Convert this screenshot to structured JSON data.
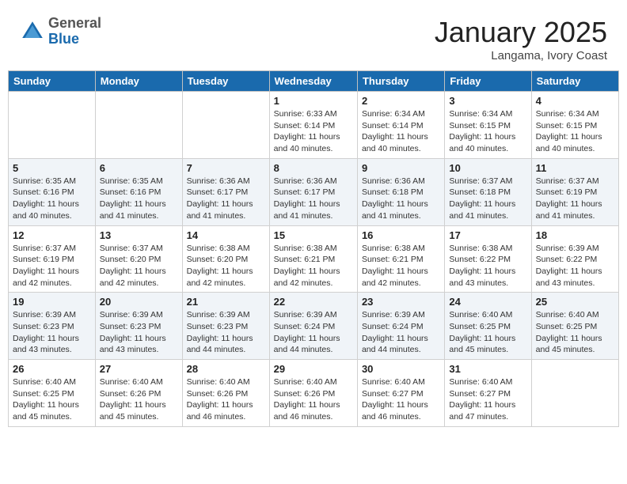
{
  "header": {
    "logo_general": "General",
    "logo_blue": "Blue",
    "month_title": "January 2025",
    "location": "Langama, Ivory Coast"
  },
  "weekdays": [
    "Sunday",
    "Monday",
    "Tuesday",
    "Wednesday",
    "Thursday",
    "Friday",
    "Saturday"
  ],
  "weeks": [
    [
      {
        "day": "",
        "info": ""
      },
      {
        "day": "",
        "info": ""
      },
      {
        "day": "",
        "info": ""
      },
      {
        "day": "1",
        "info": "Sunrise: 6:33 AM\nSunset: 6:14 PM\nDaylight: 11 hours and 40 minutes."
      },
      {
        "day": "2",
        "info": "Sunrise: 6:34 AM\nSunset: 6:14 PM\nDaylight: 11 hours and 40 minutes."
      },
      {
        "day": "3",
        "info": "Sunrise: 6:34 AM\nSunset: 6:15 PM\nDaylight: 11 hours and 40 minutes."
      },
      {
        "day": "4",
        "info": "Sunrise: 6:34 AM\nSunset: 6:15 PM\nDaylight: 11 hours and 40 minutes."
      }
    ],
    [
      {
        "day": "5",
        "info": "Sunrise: 6:35 AM\nSunset: 6:16 PM\nDaylight: 11 hours and 40 minutes."
      },
      {
        "day": "6",
        "info": "Sunrise: 6:35 AM\nSunset: 6:16 PM\nDaylight: 11 hours and 41 minutes."
      },
      {
        "day": "7",
        "info": "Sunrise: 6:36 AM\nSunset: 6:17 PM\nDaylight: 11 hours and 41 minutes."
      },
      {
        "day": "8",
        "info": "Sunrise: 6:36 AM\nSunset: 6:17 PM\nDaylight: 11 hours and 41 minutes."
      },
      {
        "day": "9",
        "info": "Sunrise: 6:36 AM\nSunset: 6:18 PM\nDaylight: 11 hours and 41 minutes."
      },
      {
        "day": "10",
        "info": "Sunrise: 6:37 AM\nSunset: 6:18 PM\nDaylight: 11 hours and 41 minutes."
      },
      {
        "day": "11",
        "info": "Sunrise: 6:37 AM\nSunset: 6:19 PM\nDaylight: 11 hours and 41 minutes."
      }
    ],
    [
      {
        "day": "12",
        "info": "Sunrise: 6:37 AM\nSunset: 6:19 PM\nDaylight: 11 hours and 42 minutes."
      },
      {
        "day": "13",
        "info": "Sunrise: 6:37 AM\nSunset: 6:20 PM\nDaylight: 11 hours and 42 minutes."
      },
      {
        "day": "14",
        "info": "Sunrise: 6:38 AM\nSunset: 6:20 PM\nDaylight: 11 hours and 42 minutes."
      },
      {
        "day": "15",
        "info": "Sunrise: 6:38 AM\nSunset: 6:21 PM\nDaylight: 11 hours and 42 minutes."
      },
      {
        "day": "16",
        "info": "Sunrise: 6:38 AM\nSunset: 6:21 PM\nDaylight: 11 hours and 42 minutes."
      },
      {
        "day": "17",
        "info": "Sunrise: 6:38 AM\nSunset: 6:22 PM\nDaylight: 11 hours and 43 minutes."
      },
      {
        "day": "18",
        "info": "Sunrise: 6:39 AM\nSunset: 6:22 PM\nDaylight: 11 hours and 43 minutes."
      }
    ],
    [
      {
        "day": "19",
        "info": "Sunrise: 6:39 AM\nSunset: 6:23 PM\nDaylight: 11 hours and 43 minutes."
      },
      {
        "day": "20",
        "info": "Sunrise: 6:39 AM\nSunset: 6:23 PM\nDaylight: 11 hours and 43 minutes."
      },
      {
        "day": "21",
        "info": "Sunrise: 6:39 AM\nSunset: 6:23 PM\nDaylight: 11 hours and 44 minutes."
      },
      {
        "day": "22",
        "info": "Sunrise: 6:39 AM\nSunset: 6:24 PM\nDaylight: 11 hours and 44 minutes."
      },
      {
        "day": "23",
        "info": "Sunrise: 6:39 AM\nSunset: 6:24 PM\nDaylight: 11 hours and 44 minutes."
      },
      {
        "day": "24",
        "info": "Sunrise: 6:40 AM\nSunset: 6:25 PM\nDaylight: 11 hours and 45 minutes."
      },
      {
        "day": "25",
        "info": "Sunrise: 6:40 AM\nSunset: 6:25 PM\nDaylight: 11 hours and 45 minutes."
      }
    ],
    [
      {
        "day": "26",
        "info": "Sunrise: 6:40 AM\nSunset: 6:25 PM\nDaylight: 11 hours and 45 minutes."
      },
      {
        "day": "27",
        "info": "Sunrise: 6:40 AM\nSunset: 6:26 PM\nDaylight: 11 hours and 45 minutes."
      },
      {
        "day": "28",
        "info": "Sunrise: 6:40 AM\nSunset: 6:26 PM\nDaylight: 11 hours and 46 minutes."
      },
      {
        "day": "29",
        "info": "Sunrise: 6:40 AM\nSunset: 6:26 PM\nDaylight: 11 hours and 46 minutes."
      },
      {
        "day": "30",
        "info": "Sunrise: 6:40 AM\nSunset: 6:27 PM\nDaylight: 11 hours and 46 minutes."
      },
      {
        "day": "31",
        "info": "Sunrise: 6:40 AM\nSunset: 6:27 PM\nDaylight: 11 hours and 47 minutes."
      },
      {
        "day": "",
        "info": ""
      }
    ]
  ]
}
